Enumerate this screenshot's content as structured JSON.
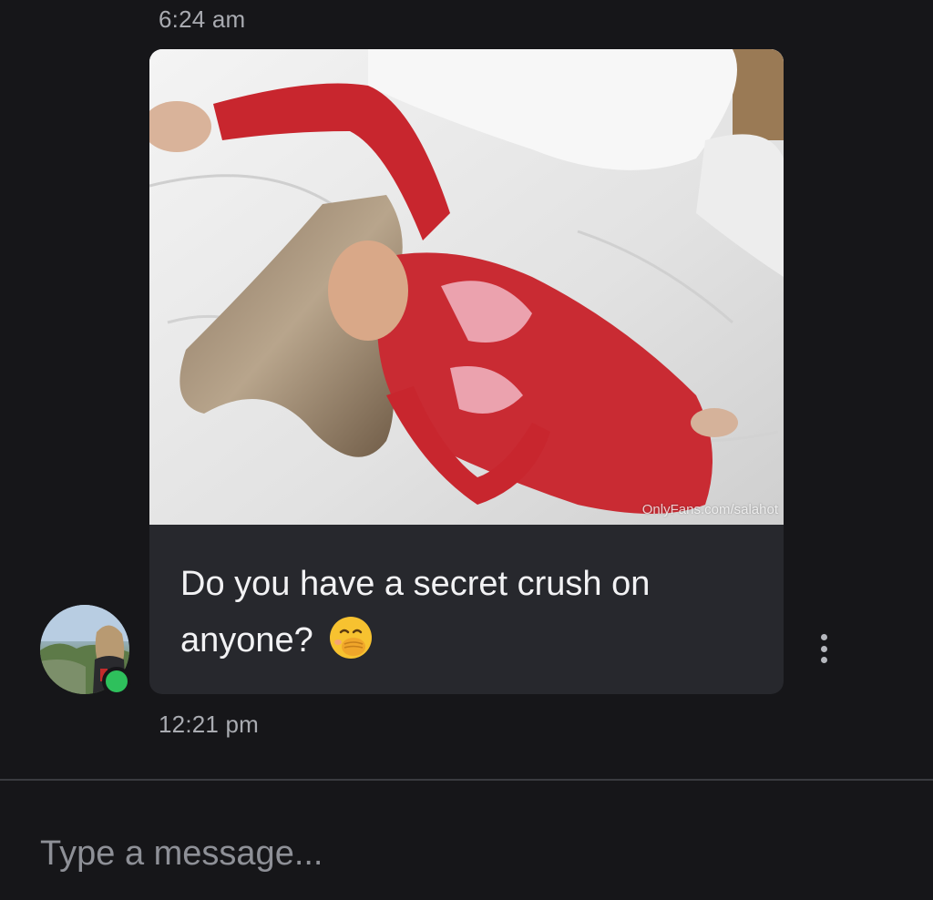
{
  "messages": {
    "top_timestamp": "6:24 am",
    "bubble": {
      "watermark": "OnlyFans.com/salahot",
      "text": "Do you have a secret crush on anyone?",
      "emoji": "face-with-hand-over-mouth"
    },
    "bottom_timestamp": "12:21 pm"
  },
  "sender": {
    "avatar_icon": "user-avatar",
    "status": "online",
    "status_color": "#2ec05c"
  },
  "composer": {
    "placeholder": "Type a message..."
  },
  "colors": {
    "background": "#161619",
    "bubble": "#27282d",
    "muted_text": "#a9abb1"
  }
}
